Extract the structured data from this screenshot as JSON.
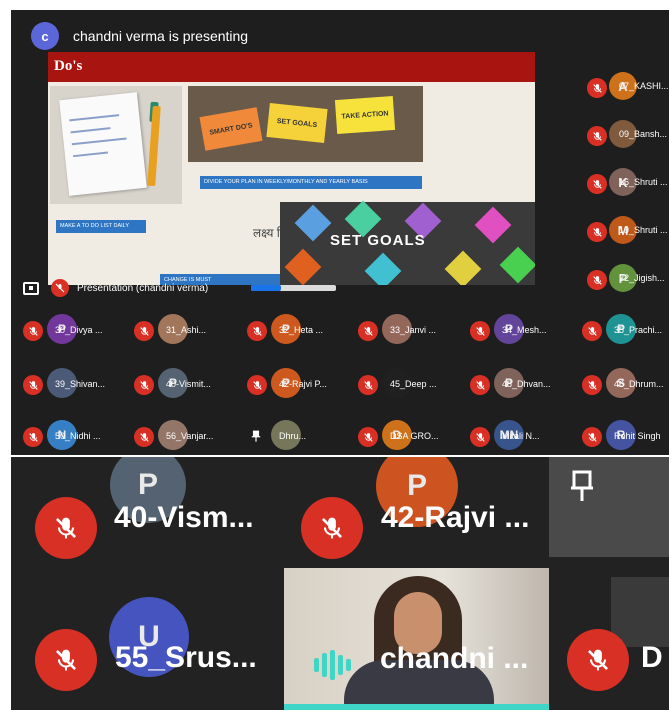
{
  "top": {
    "presenter_avatar": "c",
    "presenting_text": "chandni verma is presenting",
    "slide": {
      "title": "Do's",
      "sticky_notes": [
        "SMART DO'S",
        "SET GOALS",
        "TAKE ACTION"
      ],
      "box_divide": "DIVIDE YOUR PLAN IN WEEKLY/MONTHLY AND YEARLY BASIS",
      "box_todo": "MAKE A TO DO LIST DAILY",
      "box_third": "CHANGE IS MUST",
      "goals_text": "SET GOALS",
      "hindi_text": "लक्ष्य निर्धारित"
    },
    "presentation_label": "Presentation (chandni verma)",
    "presentation_progress": 0.35,
    "side_participants": [
      {
        "name": "07_KASHI...",
        "initial": "A",
        "color": "#e07b1a"
      },
      {
        "name": "09_Bansh...",
        "initial": "",
        "color": "#8a6040"
      },
      {
        "name": "16_Shruti ...",
        "initial": "K",
        "color": "#8a6a60"
      },
      {
        "name": "19_Shruti ...",
        "initial": "M",
        "color": "#d0601a"
      },
      {
        "name": "22_Jigish...",
        "initial": "P",
        "color": "#6aa040"
      }
    ],
    "grid_participants": [
      {
        "name": "30_Divya ...",
        "initial": "P",
        "color": "#7c3aa8",
        "mic": true
      },
      {
        "name": "31_Ashi...",
        "initial": "",
        "color": "#b08060",
        "mic": true
      },
      {
        "name": "32_Heta ...",
        "initial": "P",
        "color": "#e06020",
        "mic": true
      },
      {
        "name": "33_Janvi ...",
        "initial": "",
        "color": "#a07060",
        "mic": true
      },
      {
        "name": "34_Mesh...",
        "initial": "P",
        "color": "#6a4aa8",
        "mic": true
      },
      {
        "name": "35_Prachi...",
        "initial": "P",
        "color": "#20a0a0",
        "mic": true
      },
      {
        "name": "39_Shivan...",
        "initial": "",
        "color": "#506080",
        "mic": true
      },
      {
        "name": "40-Vismit...",
        "initial": "P",
        "color": "#5a6a7a",
        "mic": true
      },
      {
        "name": "42-Rajvi P...",
        "initial": "P",
        "color": "#e06020",
        "mic": true
      },
      {
        "name": "45_Deep ...",
        "initial": "",
        "color": "#202020",
        "mic": true
      },
      {
        "name": "48_Dhvan...",
        "initial": "P",
        "color": "#8a6a60",
        "mic": true
      },
      {
        "name": "46_Dhrum...",
        "initial": "S",
        "color": "#a07060",
        "mic": true
      },
      {
        "name": "50_Nidhi ...",
        "initial": "N",
        "color": "#3a8ad8",
        "mic": true
      },
      {
        "name": "56_Vanjar...",
        "initial": "",
        "color": "#a08070",
        "mic": true
      },
      {
        "name": "Dhru...",
        "initial": "",
        "color": "#808060",
        "mic": false
      },
      {
        "name": "DSA GRO...",
        "initial": "D",
        "color": "#e07b1a",
        "mic": true
      },
      {
        "name": "Mitali N...",
        "initial": "MN",
        "color": "#3a5a98",
        "mic": true
      },
      {
        "name": "Rohit Singh",
        "initial": "R",
        "color": "#4a5ab0",
        "mic": true
      }
    ]
  },
  "bottom": {
    "tiles": [
      {
        "name": "40-Vism...",
        "initial": "P",
        "color": "#5a6a7a"
      },
      {
        "name": "42-Rajvi ...",
        "initial": "P",
        "color": "#e05a20"
      },
      {
        "name": "55_Srus...",
        "initial": "U",
        "color": "#4a5ad0"
      },
      {
        "name": "chandni ...",
        "initial": "",
        "color": ""
      },
      {
        "name": "D",
        "initial": "",
        "color": ""
      }
    ]
  },
  "colors": {
    "mic_red": "#d93025",
    "background": "#1e1e1e",
    "speaking": "#3fd6c8",
    "slide_title": "#a8140f"
  }
}
